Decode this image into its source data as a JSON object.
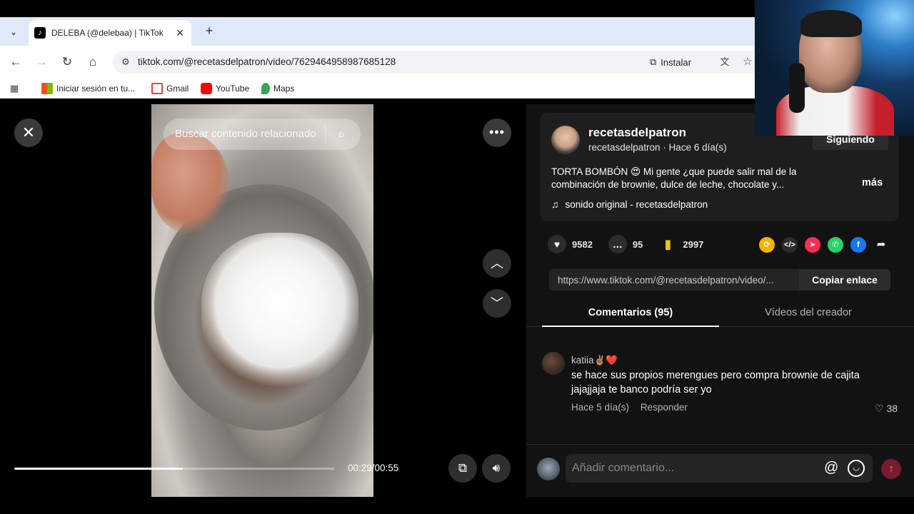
{
  "browser": {
    "tab_title": "DELEBA (@delebaa) | TikTok",
    "url": "tiktok.com/@recetasdelpatron/video/7629464958987685128",
    "install_label": "Instalar",
    "bookmarks": [
      {
        "label": "Iniciar sesión en tu...",
        "icon": "microsoft-icon"
      },
      {
        "label": "Gmail",
        "icon": "gmail-icon"
      },
      {
        "label": "YouTube",
        "icon": "youtube-icon"
      },
      {
        "label": "Maps",
        "icon": "maps-icon"
      }
    ]
  },
  "video": {
    "search_placeholder": "Buscar contenido relacionado",
    "time": "00:29/00:55",
    "progress_fraction": 0.527
  },
  "author": {
    "display_name": "recetasdelpatron",
    "subline": "recetasdelpatron · Hace 6 día(s)",
    "follow_label": "Siguiendo"
  },
  "post": {
    "description": "TORTA BOMBÓN 😍 Mi gente ¿que puede salir mal de la combinación de brownie, dulce de leche, chocolate y...",
    "more_label": "más",
    "sound": "sonido original - recetasdelpatron"
  },
  "stats": {
    "likes": "9582",
    "comments": "95",
    "saves": "2997"
  },
  "share": {
    "link": "https://www.tiktok.com/@recetasdelpatron/video/...",
    "copy_label": "Copiar enlace",
    "icons": [
      "repost-icon",
      "embed-icon",
      "send-icon",
      "whatsapp-icon",
      "facebook-icon",
      "share-arrow-icon"
    ]
  },
  "tabs": {
    "comments": "Comentarios (95)",
    "creator_videos": "Vídeos del creador"
  },
  "comment": {
    "user": "katiia✌🏽❤️",
    "text": "se hace sus propios merengues pero compra brownie de cajita jajajjaja te banco podría ser yo",
    "time": "Hace 5 día(s)",
    "reply_label": "Responder",
    "likes": "38"
  },
  "composer": {
    "placeholder": "Añadir comentario...",
    "at_symbol": "@"
  },
  "colors": {
    "page_bg": "#121212",
    "card_bg": "#1e1e1e",
    "bookmark_icon": "#f2c300",
    "whatsapp": "#25d366",
    "facebook": "#1877f2",
    "send_pink": "#fe2c55"
  }
}
